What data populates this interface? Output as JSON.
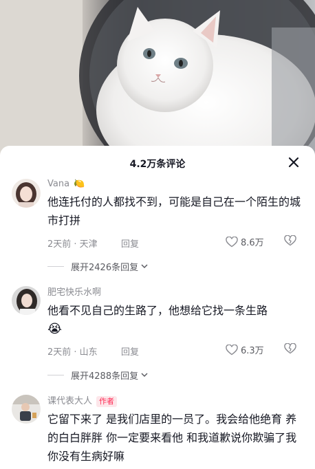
{
  "header": {
    "title": "4.2万条评论",
    "close_icon": "close-icon"
  },
  "comments": [
    {
      "username": "Vana",
      "username_emoji": "🍋",
      "text": "他连托付的人都找不到，可能是自己在一个陌生的城市打拼",
      "time_location": "2天前 · 天津",
      "reply_label": "回复",
      "likes": "8.6万",
      "expand_label": "展开2426条回复"
    },
    {
      "username": "肥宅快乐水啊",
      "text": "他看不见自己的生路了，他想给它找一条生路",
      "emoji": "😭",
      "time_location": "2天前 · 山东",
      "reply_label": "回复",
      "likes": "6.3万",
      "expand_label": "展开4288条回复"
    },
    {
      "username": "课代表大人",
      "author_tag": "作者",
      "text": "它留下来了 是我们店里的一员了。我会给他绝育 养的白白胖胖 你一定要来看他 和我道歉说你欺骗了我 你没有生病好嘛"
    }
  ],
  "colors": {
    "accent": "#fe2c55",
    "muted": "#8a8b91",
    "text": "#161823"
  }
}
